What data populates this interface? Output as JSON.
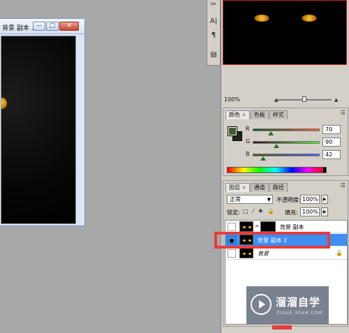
{
  "document_window": {
    "title": "背景 副本 ...",
    "buttons": {
      "minimize": "—",
      "maximize": "□",
      "close": "✕"
    }
  },
  "tools": {
    "icons": [
      "scissors-icon",
      "text-icon",
      "paragraph-icon",
      "panel-icon"
    ],
    "glyphs": [
      "✂",
      "A|",
      "¶",
      "▤"
    ]
  },
  "navigator": {
    "zoom": "100%"
  },
  "color_panel": {
    "tabs": [
      "颜色",
      "色板",
      "样式"
    ],
    "channels": [
      {
        "label": "R",
        "value": "70",
        "position": 0.27
      },
      {
        "label": "G",
        "value": "90",
        "position": 0.35
      },
      {
        "label": "B",
        "value": "42",
        "position": 0.16
      }
    ],
    "foreground_color": "#465a2a"
  },
  "layers_panel": {
    "tabs": [
      "图层",
      "通道",
      "路径"
    ],
    "blend_mode": "正常",
    "opacity_label": "不透明度:",
    "opacity_value": "100%",
    "lock_label": "锁定:",
    "fill_label": "填充:",
    "fill_value": "100%",
    "layers": [
      {
        "name": "背景 副本",
        "visible": false,
        "selected": false,
        "has_mask": true
      },
      {
        "name": "背景 副本 2",
        "visible": true,
        "selected": true,
        "has_mask": false
      },
      {
        "name": "背景",
        "visible": false,
        "selected": false,
        "has_mask": false,
        "locked": true
      }
    ]
  },
  "watermark": {
    "text": "溜溜自学",
    "sub": "ZIXUE.3D66.COM"
  },
  "colors": {
    "selection": "#3d8ff2",
    "highlight": "#e83c3c"
  }
}
